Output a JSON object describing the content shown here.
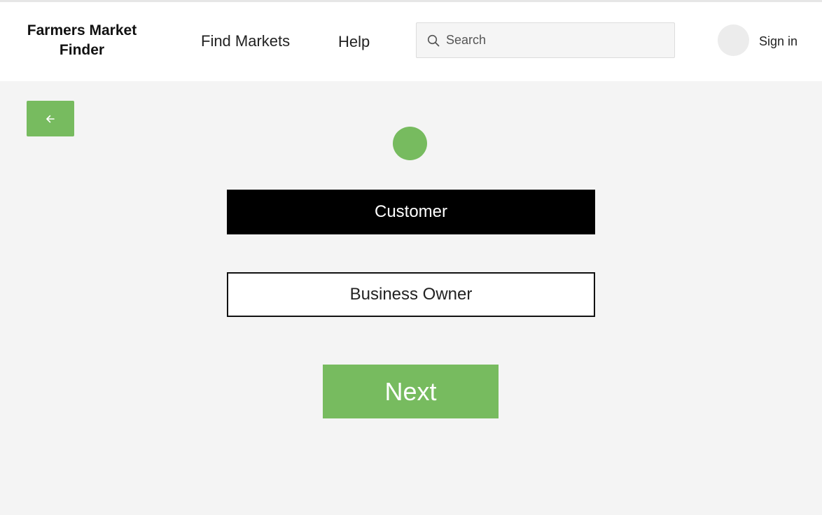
{
  "header": {
    "brand_line1": "Farmers Market",
    "brand_line2": "Finder",
    "nav": {
      "find_markets": "Find Markets",
      "help": "Help"
    },
    "search": {
      "placeholder": "Search",
      "value": ""
    },
    "sign_in_label": "Sign in"
  },
  "main": {
    "role_options": [
      {
        "label": "Customer",
        "selected": true
      },
      {
        "label": "Business Owner",
        "selected": false
      }
    ],
    "next_label": "Next"
  },
  "icons": {
    "search": "search-icon",
    "back": "arrow-left-icon"
  },
  "colors": {
    "accent_green": "#77bb5f",
    "selected_option": "#000000",
    "background": "#f4f4f4",
    "header_background": "#ffffff"
  }
}
